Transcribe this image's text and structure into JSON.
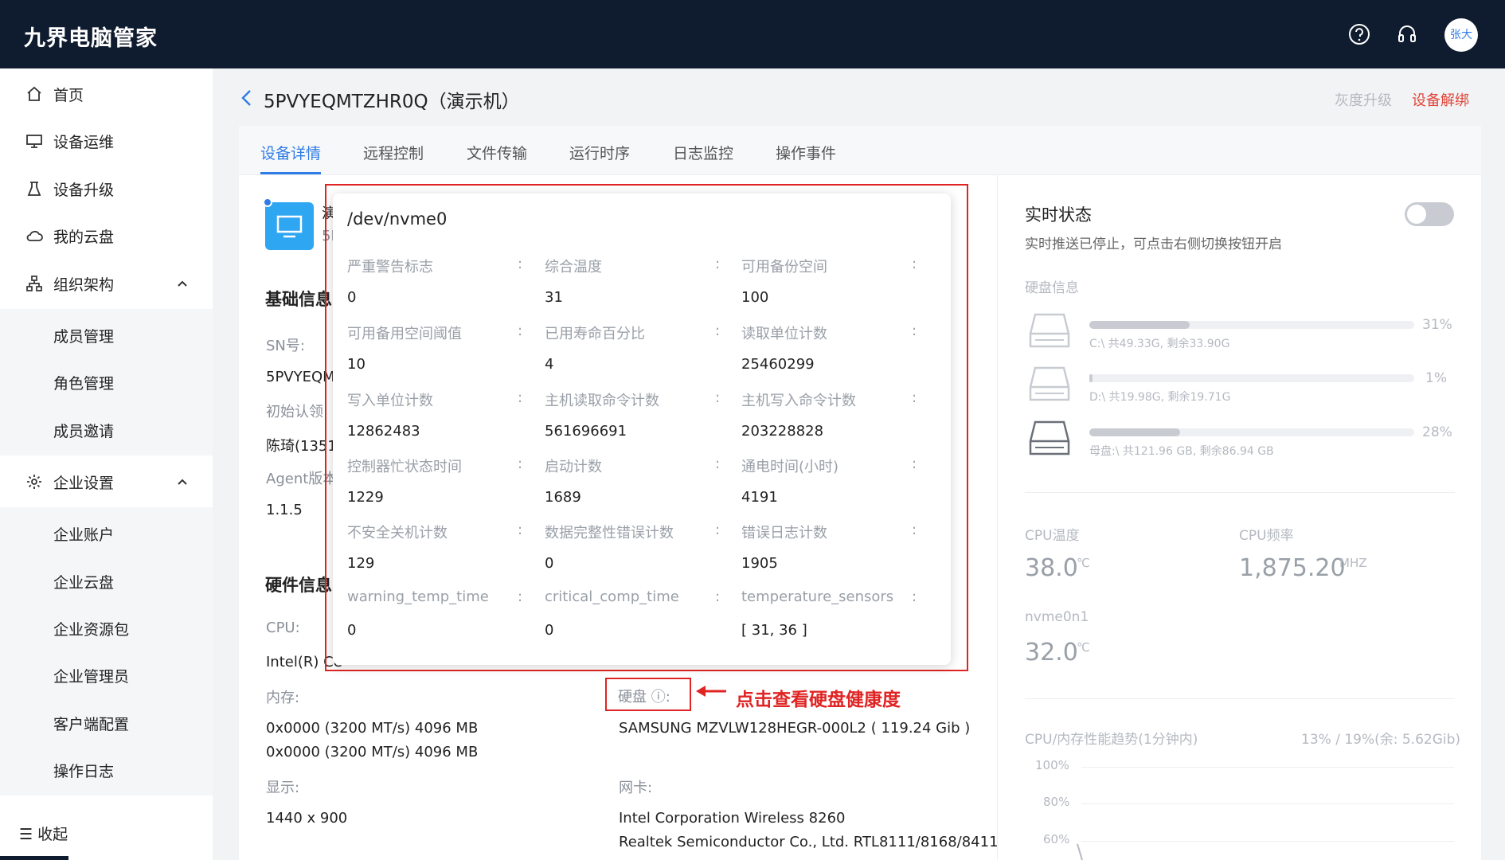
{
  "header": {
    "app_title": "九界电脑管家",
    "avatar_text": "张大"
  },
  "sidebar": {
    "items": [
      {
        "label": "首页"
      },
      {
        "label": "设备运维"
      },
      {
        "label": "设备升级"
      },
      {
        "label": "我的云盘"
      },
      {
        "label": "组织架构"
      },
      {
        "label": "企业设置"
      }
    ],
    "org_sub": [
      "成员管理",
      "角色管理",
      "成员邀请"
    ],
    "ent_sub": [
      "企业账户",
      "企业云盘",
      "企业资源包",
      "企业管理员",
      "客户端配置",
      "操作日志"
    ],
    "collapse_label": "收起"
  },
  "page": {
    "title": "5PVYEQMTZHR0Q（演示机）",
    "gray_upgrade": "灰度升级",
    "unbind": "设备解绑"
  },
  "tabs": [
    "设备详情",
    "远程控制",
    "文件传输",
    "运行时序",
    "日志监控",
    "操作事件"
  ],
  "detail": {
    "name_partial": "演",
    "sub_partial": "5I",
    "basic_title": "基础信息",
    "sn_label": "SN号:",
    "sn_value": "5PVYEQM",
    "initial_label": "初始认领",
    "initial_value": "陈琦(1351",
    "agent_label": "Agent版本",
    "agent_value": "1.1.5",
    "hw_title": "硬件信息",
    "cpu_label": "CPU:",
    "cpu_value": "Intel(R) Ce",
    "mem_label": "内存:",
    "mem_values": [
      "0x0000 (3200 MT/s) 4096 MB",
      "0x0000 (3200 MT/s) 4096 MB"
    ],
    "display_label": "显示:",
    "display_value": "1440 x 900",
    "disk_label": "硬盘 ⓘ:",
    "disk_value": "SAMSUNG MZVLW128HEGR-000L2 ( 119.24 Gib )",
    "nic_label": "网卡:",
    "nic_values": [
      "Intel Corporation Wireless 8260",
      "Realtek Semiconductor Co., Ltd. RTL8111/8168/8411"
    ]
  },
  "annotation": "点击查看硬盘健康度",
  "popup": {
    "title": "/dev/nvme0",
    "rows": [
      [
        {
          "label": "严重警告标志",
          "value": "0"
        },
        {
          "label": "综合温度",
          "value": "31"
        },
        {
          "label": "可用备份空间",
          "value": "100"
        }
      ],
      [
        {
          "label": "可用备用空间阈值",
          "value": "10"
        },
        {
          "label": "已用寿命百分比",
          "value": "4"
        },
        {
          "label": "读取单位计数",
          "value": "25460299"
        }
      ],
      [
        {
          "label": "写入单位计数",
          "value": "12862483"
        },
        {
          "label": "主机读取命令计数",
          "value": "561696691"
        },
        {
          "label": "主机写入命令计数",
          "value": "203228828"
        }
      ],
      [
        {
          "label": "控制器忙状态时间",
          "value": "1229"
        },
        {
          "label": "启动计数",
          "value": "1689"
        },
        {
          "label": "通电时间(小时)",
          "value": "4191"
        }
      ],
      [
        {
          "label": "不安全关机计数",
          "value": "129"
        },
        {
          "label": "数据完整性错误计数",
          "value": "0"
        },
        {
          "label": "错误日志计数",
          "value": "1905"
        }
      ],
      [
        {
          "label": "warning_temp_time",
          "value": "0"
        },
        {
          "label": "critical_comp_time",
          "value": "0"
        },
        {
          "label": "temperature_sensors",
          "value": "[ 31, 36 ]"
        }
      ]
    ]
  },
  "realtime": {
    "title": "实时状态",
    "subtitle": "实时推送已停止，可点击右侧切换按钮开启",
    "disk_info_label": "硬盘信息",
    "disks": [
      {
        "pct_text": "31%",
        "pct": 31,
        "text": "C:\\ 共49.33G, 剩余33.90G"
      },
      {
        "pct_text": "1%",
        "pct": 1,
        "text": "D:\\ 共19.98G, 剩余19.71G"
      },
      {
        "pct_text": "28%",
        "pct": 28,
        "text": "母盘:\\ 共121.96 GB, 剩余86.94 GB"
      }
    ],
    "cpu_temp_label": "CPU温度",
    "cpu_temp": "38.0",
    "cpu_temp_unit": "℃",
    "cpu_freq_label": "CPU频率",
    "cpu_freq": "1,875.20",
    "cpu_freq_unit": "MHZ",
    "nvme_label": "nvme0n1",
    "nvme_temp": "32.0",
    "nvme_unit": "℃",
    "trend_label": "CPU/内存性能趋势(1分钟内)",
    "trend_value": "13% / 19%(余: 5.62Gib)",
    "axis": [
      "100%",
      "80%",
      "60%"
    ]
  }
}
